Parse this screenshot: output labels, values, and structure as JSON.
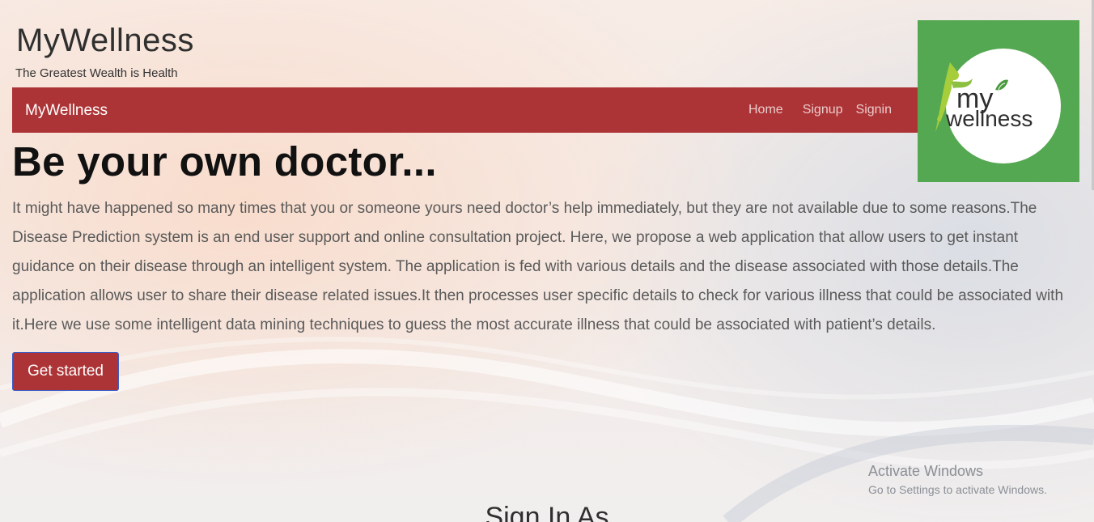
{
  "header": {
    "title": "MyWellness",
    "tagline": "The Greatest Wealth is Health"
  },
  "navbar": {
    "brand": "MyWellness",
    "links": [
      "Home",
      "Signup",
      "Signin"
    ],
    "background": "#ad3436"
  },
  "logo": {
    "text_line1": "my",
    "text_line2": "wellness",
    "background": "#55a852"
  },
  "hero": {
    "title": "Be your own doctor...",
    "description": "It might have happened so many times that you or someone yours need doctor’s help immediately, but they are not available due to some reasons.The Disease Prediction system is an end user support and online consultation project. Here, we propose a web application that allow users to get instant guidance on their disease through an intelligent system. The application is fed with various details and the disease associated with those details.The application allows user to share their disease related issues.It then processes user specific details to check for various illness that could be associated with it.Here we use some intelligent data mining techniques to guess the most accurate illness that could be associated with patient’s details.",
    "cta_label": "Get started"
  },
  "section": {
    "heading": "Sign In As"
  },
  "watermark": {
    "title": "Activate Windows",
    "subtitle": "Go to Settings to activate Windows."
  }
}
